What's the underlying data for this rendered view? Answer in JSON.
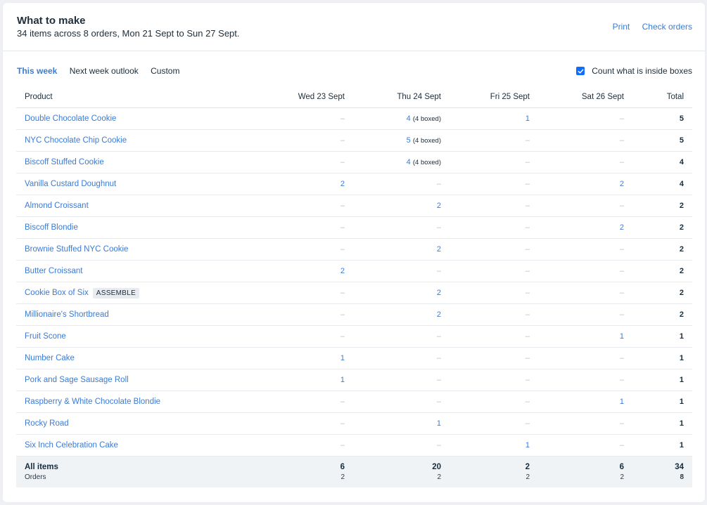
{
  "header": {
    "title": "What to make",
    "subtitle": "34 items across 8 orders, Mon 21 Sept to Sun 27 Sept.",
    "print_label": "Print",
    "check_orders_label": "Check orders"
  },
  "filters": {
    "this_week": "This week",
    "next_week": "Next week outlook",
    "custom": "Custom"
  },
  "count_boxes": {
    "label": "Count what is inside boxes",
    "checked": true
  },
  "table": {
    "columns": [
      "Product",
      "Wed 23 Sept",
      "Thu 24 Sept",
      "Fri 25 Sept",
      "Sat 26 Sept",
      "Total"
    ],
    "dash": "–",
    "rows": [
      {
        "product": "Double Chocolate Cookie",
        "badge": "",
        "cells": [
          {
            "v": "",
            "b": ""
          },
          {
            "v": "4",
            "b": "(4 boxed)"
          },
          {
            "v": "1",
            "b": ""
          },
          {
            "v": "",
            "b": ""
          }
        ],
        "total": "5"
      },
      {
        "product": "NYC Chocolate Chip Cookie",
        "badge": "",
        "cells": [
          {
            "v": "",
            "b": ""
          },
          {
            "v": "5",
            "b": "(4 boxed)"
          },
          {
            "v": "",
            "b": ""
          },
          {
            "v": "",
            "b": ""
          }
        ],
        "total": "5"
      },
      {
        "product": "Biscoff Stuffed Cookie",
        "badge": "",
        "cells": [
          {
            "v": "",
            "b": ""
          },
          {
            "v": "4",
            "b": "(4 boxed)"
          },
          {
            "v": "",
            "b": ""
          },
          {
            "v": "",
            "b": ""
          }
        ],
        "total": "4"
      },
      {
        "product": "Vanilla Custard Doughnut",
        "badge": "",
        "cells": [
          {
            "v": "2",
            "b": ""
          },
          {
            "v": "",
            "b": ""
          },
          {
            "v": "",
            "b": ""
          },
          {
            "v": "2",
            "b": ""
          }
        ],
        "total": "4"
      },
      {
        "product": "Almond Croissant",
        "badge": "",
        "cells": [
          {
            "v": "",
            "b": ""
          },
          {
            "v": "2",
            "b": ""
          },
          {
            "v": "",
            "b": ""
          },
          {
            "v": "",
            "b": ""
          }
        ],
        "total": "2"
      },
      {
        "product": "Biscoff Blondie",
        "badge": "",
        "cells": [
          {
            "v": "",
            "b": ""
          },
          {
            "v": "",
            "b": ""
          },
          {
            "v": "",
            "b": ""
          },
          {
            "v": "2",
            "b": ""
          }
        ],
        "total": "2"
      },
      {
        "product": "Brownie Stuffed NYC Cookie",
        "badge": "",
        "cells": [
          {
            "v": "",
            "b": ""
          },
          {
            "v": "2",
            "b": ""
          },
          {
            "v": "",
            "b": ""
          },
          {
            "v": "",
            "b": ""
          }
        ],
        "total": "2"
      },
      {
        "product": "Butter Croissant",
        "badge": "",
        "cells": [
          {
            "v": "2",
            "b": ""
          },
          {
            "v": "",
            "b": ""
          },
          {
            "v": "",
            "b": ""
          },
          {
            "v": "",
            "b": ""
          }
        ],
        "total": "2"
      },
      {
        "product": "Cookie Box of Six",
        "badge": "ASSEMBLE",
        "cells": [
          {
            "v": "",
            "b": ""
          },
          {
            "v": "2",
            "b": ""
          },
          {
            "v": "",
            "b": ""
          },
          {
            "v": "",
            "b": ""
          }
        ],
        "total": "2"
      },
      {
        "product": "Millionaire's Shortbread",
        "badge": "",
        "cells": [
          {
            "v": "",
            "b": ""
          },
          {
            "v": "2",
            "b": ""
          },
          {
            "v": "",
            "b": ""
          },
          {
            "v": "",
            "b": ""
          }
        ],
        "total": "2"
      },
      {
        "product": "Fruit Scone",
        "badge": "",
        "cells": [
          {
            "v": "",
            "b": ""
          },
          {
            "v": "",
            "b": ""
          },
          {
            "v": "",
            "b": ""
          },
          {
            "v": "1",
            "b": ""
          }
        ],
        "total": "1"
      },
      {
        "product": "Number Cake",
        "badge": "",
        "cells": [
          {
            "v": "1",
            "b": ""
          },
          {
            "v": "",
            "b": ""
          },
          {
            "v": "",
            "b": ""
          },
          {
            "v": "",
            "b": ""
          }
        ],
        "total": "1"
      },
      {
        "product": "Pork and Sage Sausage Roll",
        "badge": "",
        "cells": [
          {
            "v": "1",
            "b": ""
          },
          {
            "v": "",
            "b": ""
          },
          {
            "v": "",
            "b": ""
          },
          {
            "v": "",
            "b": ""
          }
        ],
        "total": "1"
      },
      {
        "product": "Raspberry & White Chocolate Blondie",
        "badge": "",
        "cells": [
          {
            "v": "",
            "b": ""
          },
          {
            "v": "",
            "b": ""
          },
          {
            "v": "",
            "b": ""
          },
          {
            "v": "1",
            "b": ""
          }
        ],
        "total": "1"
      },
      {
        "product": "Rocky Road",
        "badge": "",
        "cells": [
          {
            "v": "",
            "b": ""
          },
          {
            "v": "1",
            "b": ""
          },
          {
            "v": "",
            "b": ""
          },
          {
            "v": "",
            "b": ""
          }
        ],
        "total": "1"
      },
      {
        "product": "Six Inch Celebration Cake",
        "badge": "",
        "cells": [
          {
            "v": "",
            "b": ""
          },
          {
            "v": "",
            "b": ""
          },
          {
            "v": "1",
            "b": ""
          },
          {
            "v": "",
            "b": ""
          }
        ],
        "total": "1"
      }
    ],
    "footer": {
      "label": "All items",
      "sublabel": "Orders",
      "items": [
        "6",
        "20",
        "2",
        "6",
        "34"
      ],
      "orders": [
        "2",
        "2",
        "2",
        "2",
        "8"
      ]
    }
  },
  "colors": {
    "link": "#3b7bd6",
    "accent": "#116dff",
    "footer_bg": "#f0f3f6"
  }
}
